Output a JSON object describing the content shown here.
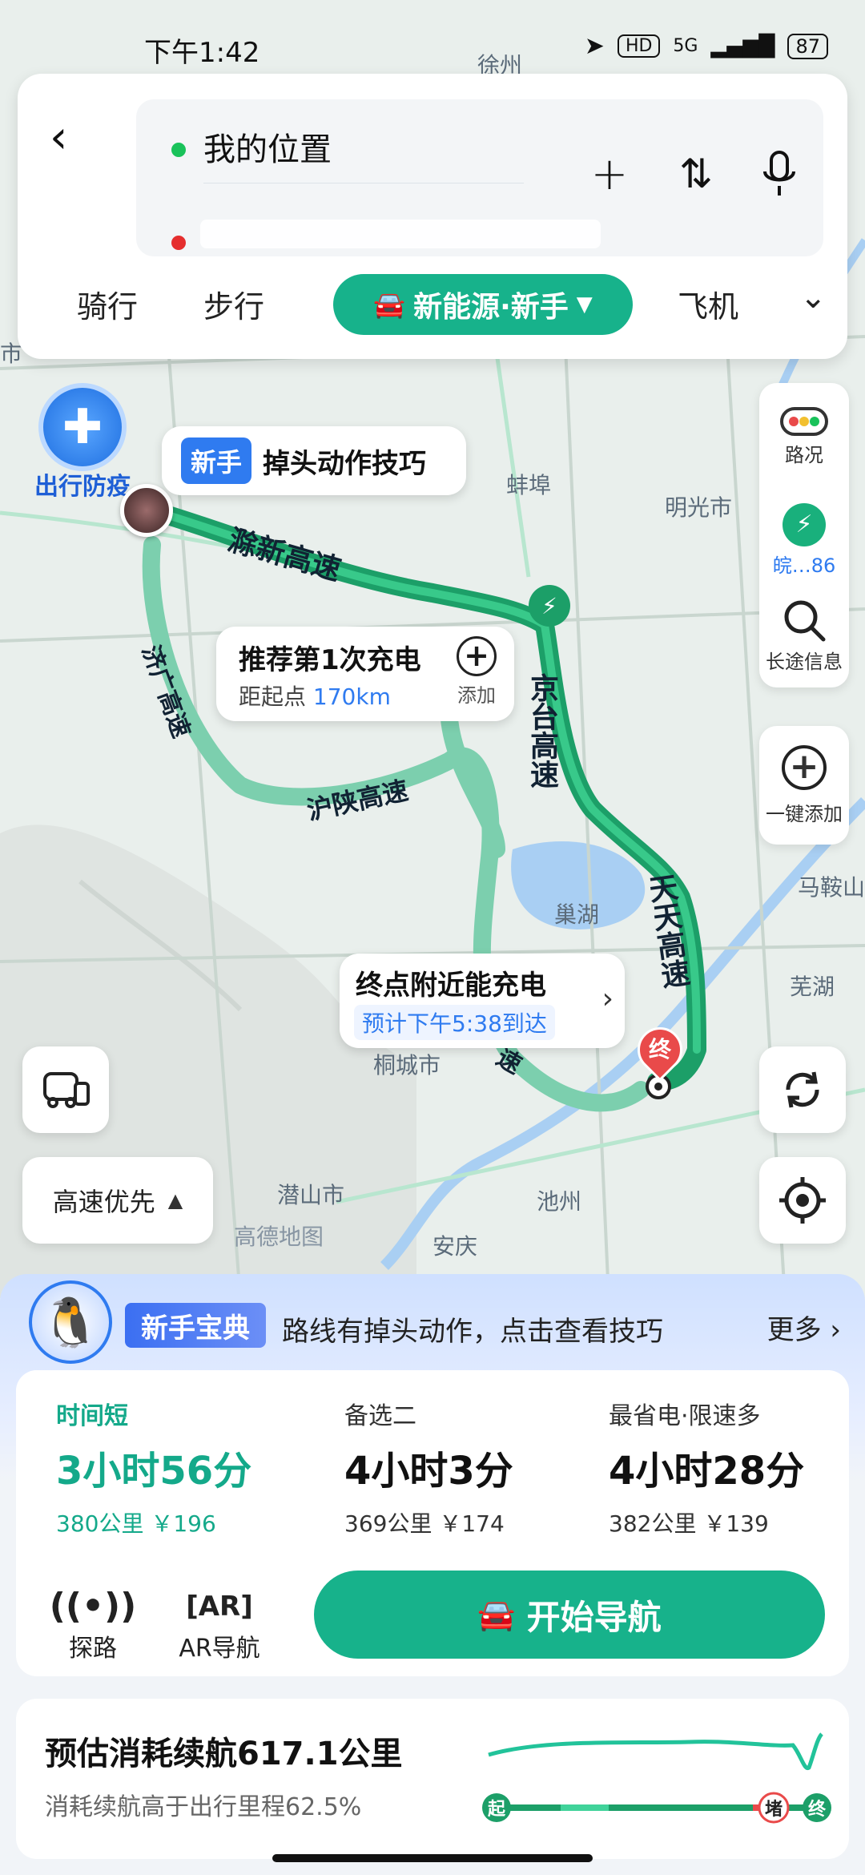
{
  "status_bar": {
    "time": "下午1:42",
    "hd": "HD",
    "network": "5G",
    "battery": "87"
  },
  "search": {
    "start": "我的位置",
    "destination": ""
  },
  "modes": {
    "bike": "骑行",
    "walk": "步行",
    "active": "新能源·新手",
    "plane": "飞机"
  },
  "right_tools": {
    "traffic": "路况",
    "plate": "皖…86",
    "longtrip": "长途信息",
    "oneclick_add": "一键添加"
  },
  "map": {
    "epidemic": "出行防疫",
    "uturn_tag": "新手",
    "uturn_tip": "掉头动作技巧",
    "charge_title": "推荐第1次充电",
    "charge_dist_prefix": "距起点",
    "charge_dist": "170km",
    "charge_add": "添加",
    "dest_charge_title": "终点附近能充电",
    "dest_eta": "预计下午5:38到达",
    "end_marker": "终",
    "route_pref": "高速优先",
    "labels": {
      "bengbu": "蚌埠",
      "mingguang": "明光市",
      "maanshan": "马鞍山",
      "wuhu": "芜湖",
      "chaohu": "巢湖",
      "tongcheng": "桐城市",
      "qianshan": "潜山市",
      "chizhou": "池州",
      "anqing": "安庆",
      "xuzhou": "徐州",
      "shi": "市",
      "watermark": "高德地图"
    },
    "highways": {
      "chuxin": "滁新高速",
      "jiguang": "济广高速",
      "hushan": "沪陕高速",
      "jingtai": "京台高速",
      "tiantian": "天天高速",
      "su": "速"
    }
  },
  "tips": {
    "badge": "新手宝典",
    "text": "路线有掉头动作，点击查看技巧",
    "more": "更多"
  },
  "routes": [
    {
      "name": "时间短",
      "time": "3小时56分",
      "meta": "380公里 ￥196"
    },
    {
      "name": "备选二",
      "time": "4小时3分",
      "meta": "369公里 ￥174"
    },
    {
      "name": "最省电·限速多",
      "time": "4小时28分",
      "meta": "382公里 ￥139"
    }
  ],
  "actions": {
    "explore": "探路",
    "ar": "AR导航",
    "start": "开始导航"
  },
  "energy": {
    "title": "预估消耗续航617.1公里",
    "sub": "消耗续航高于出行里程62.5%",
    "start": "起",
    "jam": "堵",
    "end": "终"
  },
  "colors": {
    "route_green": "#17b28b",
    "primary_blue": "#2f7bf0",
    "end_red": "#e94a4a"
  }
}
